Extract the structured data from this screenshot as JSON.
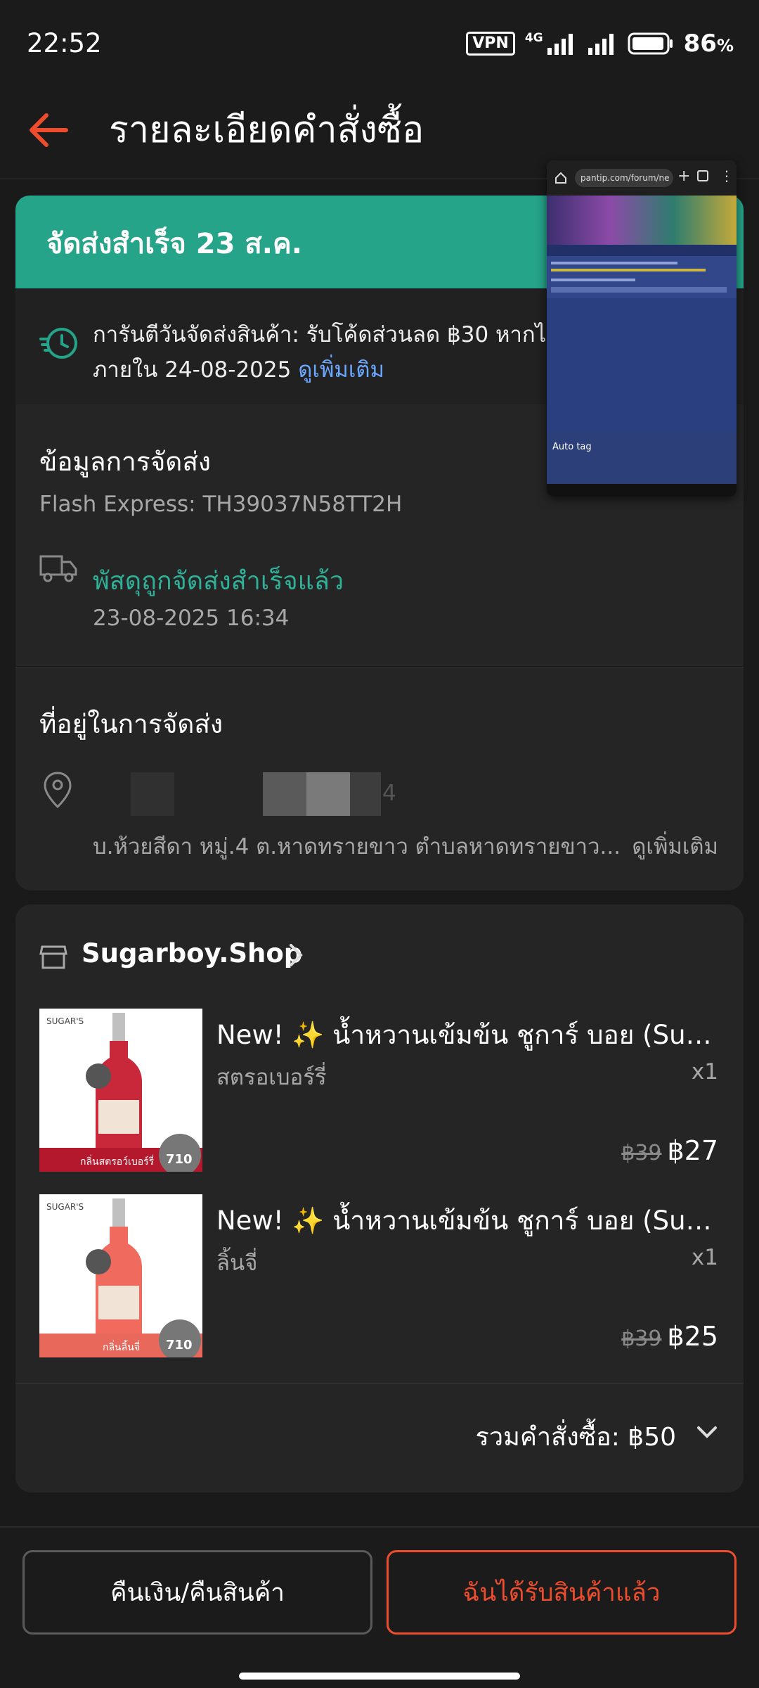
{
  "status_bar": {
    "time": "22:52",
    "vpn": "VPN",
    "network": "4G",
    "battery": "86",
    "battery_unit": "%"
  },
  "header": {
    "title": "รายละเอียดคำสั่งซื้อ",
    "back_icon": "arrow-left-icon"
  },
  "banner": {
    "text": "จัดส่งสำเร็จ 23 ส.ค."
  },
  "guarantee": {
    "line1": "การันตีวันจัดส่งสินค้า: รับโค้ดส่วนลด ฿30 หากไ",
    "line2": "ภายใน 24-08-2025",
    "more_link": "ดูเพิ่มเติม"
  },
  "shipping": {
    "title": "ข้อมูลการจัดส่ง",
    "courier": "Flash Express: TH39037N58TT2H",
    "status": "พัสดุถูกจัดส่งสำเร็จแล้ว",
    "status_time": "23-08-2025 16:34"
  },
  "address": {
    "title": "ที่อยู่ในการจัดส่ง",
    "line": "บ.ห้วยสีดา หมู่.4 ต.หาดทรายขาว ตำบลหาดทรายขาว...",
    "more": "ดูเพิ่มเติม",
    "redacted_tail": "4"
  },
  "shop": {
    "name": "Sugarboy.Shop",
    "items": [
      {
        "title": "New! ✨ น้ำหวานเข้มข้น ชูการ์ บอย (Suga...",
        "variant": "สตรอเบอร์รี่",
        "qty": "x1",
        "price_old": "฿39",
        "price_new": "฿27",
        "thumb_label": "กลิ่นสตรอว์เบอร์รี่",
        "thumb_size": "710",
        "brand": "SUGAR'S"
      },
      {
        "title": "New! ✨ น้ำหวานเข้มข้น ชูการ์ บอย (Suga...",
        "variant": "ลิ้นจี่",
        "qty": "x1",
        "price_old": "฿39",
        "price_new": "฿25",
        "thumb_label": "กลิ่นลิ้นจี่",
        "thumb_size": "710",
        "brand": "SUGAR'S"
      }
    ],
    "total": "รวมคำสั่งซื้อ: ฿50"
  },
  "actions": {
    "return_label": "คืนเงิน/คืนสินค้า",
    "received_label": "ฉันได้รับสินค้าแล้ว"
  },
  "pip": {
    "url": "pantip.com/forum/ne",
    "autotag": "Auto tag"
  },
  "colors": {
    "accent": "#ee4d2d",
    "banner": "#26a48a",
    "success_text": "#2fb097",
    "link": "#6aa8ff"
  }
}
